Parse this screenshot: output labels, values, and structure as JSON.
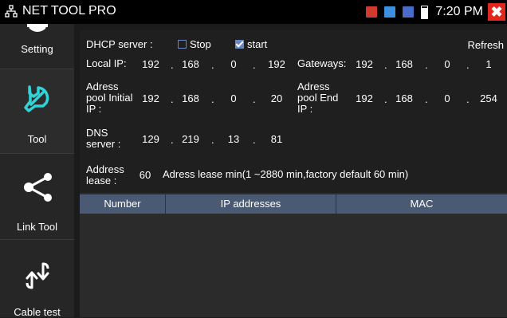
{
  "app": {
    "title": "NET TOOL PRO",
    "time": "7:20 PM",
    "close_glyph": "✖",
    "icons": [
      "network-icon",
      "alert-red-icon",
      "info-blue-icon",
      "tools-blue-icon",
      "battery-icon",
      "close-icon"
    ]
  },
  "sidebar": {
    "items": [
      {
        "label": "Setting",
        "icon": "gear-icon"
      },
      {
        "label": "Tool",
        "icon": "wrench-icon"
      },
      {
        "label": "Link Tool",
        "icon": "share-icon"
      },
      {
        "label": "Cable test",
        "icon": "cable-test-icon"
      }
    ]
  },
  "dhcp": {
    "server_label": "DHCP server :",
    "stop_label": "Stop",
    "stop_checked": false,
    "start_label": "start",
    "start_checked": true,
    "refresh_label": "Refresh",
    "local_ip_label": "Local IP:",
    "local_ip": [
      "192",
      "168",
      "0",
      "192"
    ],
    "gateways_label": "Gateways:",
    "gateways": [
      "192",
      "168",
      "0",
      "1"
    ],
    "pool_initial_label": [
      "Adress",
      "pool Initial",
      "IP :"
    ],
    "pool_initial": [
      "192",
      "168",
      "0",
      "20"
    ],
    "pool_end_label": [
      "Adress",
      "pool End",
      "IP :"
    ],
    "pool_end": [
      "192",
      "168",
      "0",
      "254"
    ],
    "dns_label": [
      "DNS",
      "server :"
    ],
    "dns": [
      "129",
      "219",
      "13",
      "81"
    ],
    "lease_label": [
      "Address",
      "lease :"
    ],
    "lease_value": "60",
    "lease_note": "Adress lease min(1 ~2880 min,factory default 60 min)"
  },
  "table": {
    "columns": [
      "Number",
      "IP addresses",
      "MAC"
    ],
    "rows": []
  },
  "colors": {
    "accent": "#6b86c7",
    "header": "#4a5a72",
    "close": "#e0261d"
  }
}
